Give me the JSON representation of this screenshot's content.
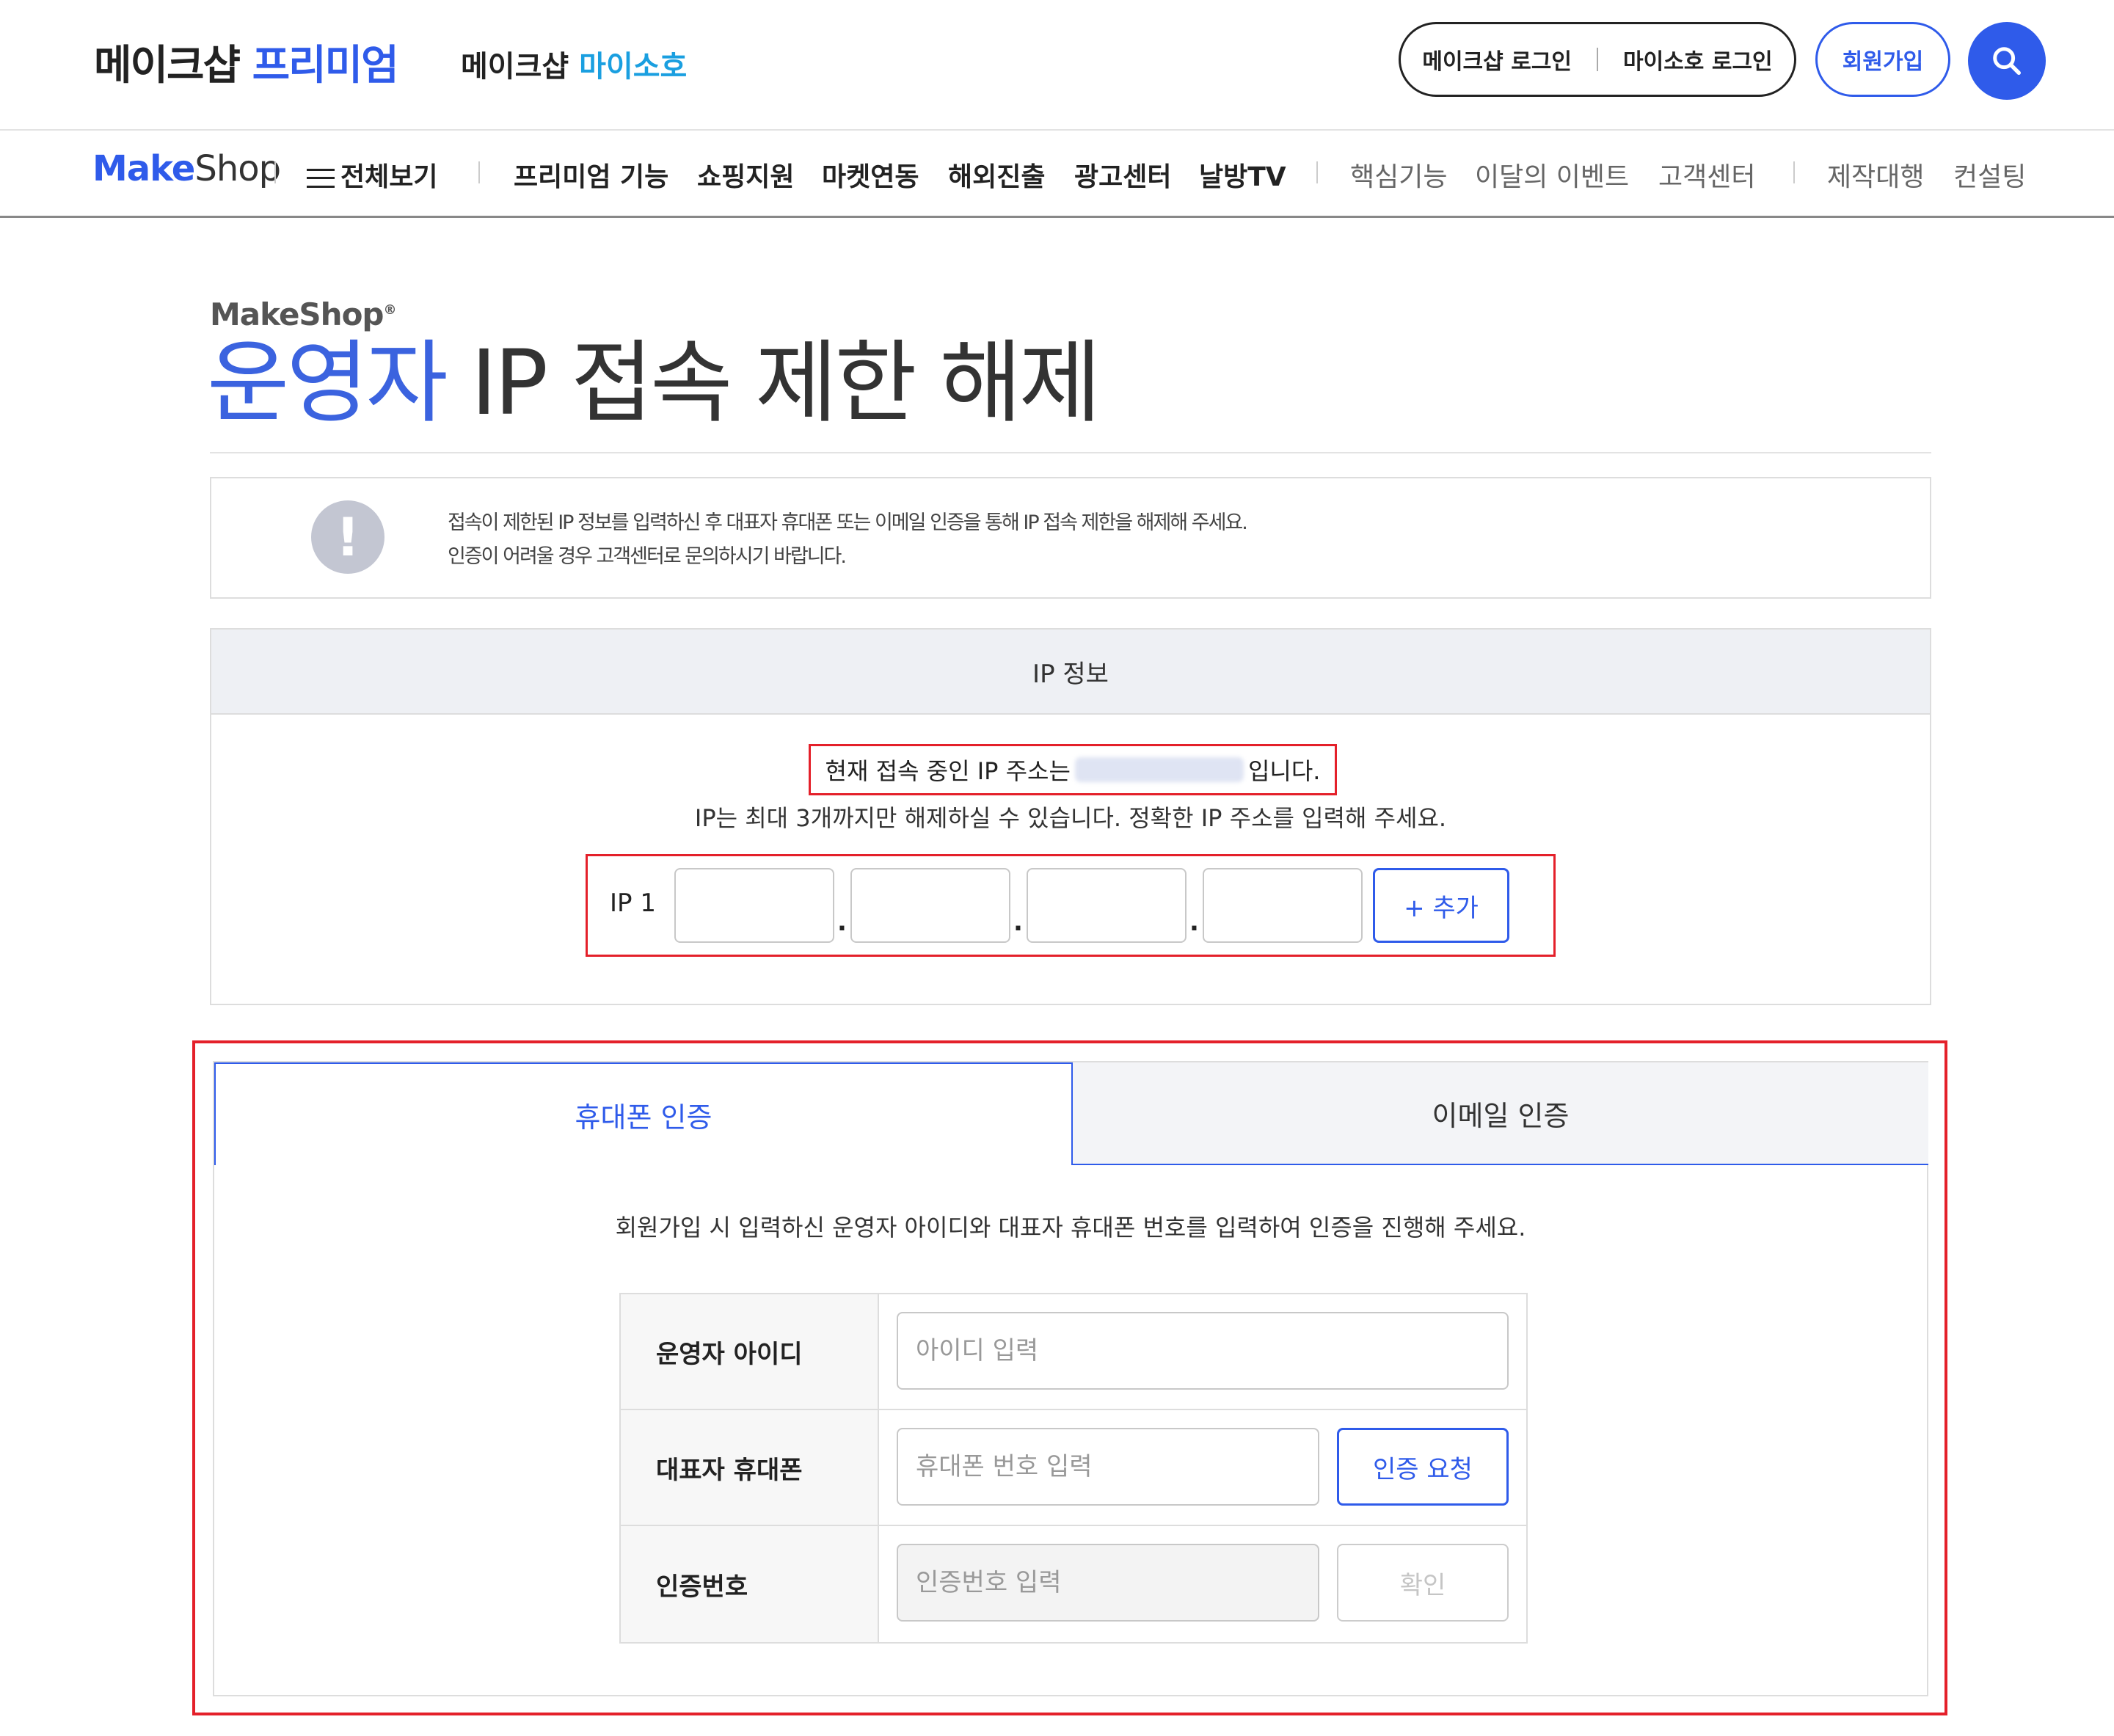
{
  "header": {
    "brand_premium_main": "메이크샵",
    "brand_premium_accent": "프리미엄",
    "brand_myshop_main": "메이크샵",
    "brand_myshop_accent": "마이소호",
    "makeshop_login": "메이크샵 로그인",
    "myshop_login": "마이소호 로그인",
    "join": "회원가입",
    "search_icon": "search-icon"
  },
  "nav": {
    "logo_make": "Make",
    "logo_shop": "Shop",
    "all_menu": "전체보기",
    "items_primary": [
      "프리미엄 기능",
      "쇼핑지원",
      "마켓연동",
      "해외진출",
      "광고센터",
      "날방TV"
    ],
    "items_secondary": [
      "핵심기능",
      "이달의 이벤트",
      "고객센터"
    ],
    "items_tertiary": [
      "제작대행",
      "컨설팅"
    ]
  },
  "page": {
    "logo": "MakeShop",
    "logo_mark": "®",
    "title_accent": "운영자",
    "title_rest": "IP 접속 제한 해제"
  },
  "notice": {
    "line1": "접속이 제한된 IP 정보를 입력하신 후 대표자 휴대폰 또는 이메일 인증을 통해 IP 접속 제한을 해제해 주세요.",
    "line2": "인증이 어려울 경우 고객센터로 문의하시기 바랍니다.",
    "icon": "exclamation-icon"
  },
  "ip_info": {
    "header": "IP 정보",
    "current_prefix": "현재 접속 중인 IP 주소는",
    "current_suffix": "입니다.",
    "help": "IP는 최대 3개까지만 해제하실 수 있습니다. 정확한 IP 주소를 입력해 주세요.",
    "ip_label": "IP 1",
    "dot": ".",
    "add_button": "+ 추가"
  },
  "auth": {
    "tab_phone": "휴대폰 인증",
    "tab_email": "이메일 인증",
    "description": "회원가입 시 입력하신 운영자 아이디와 대표자 휴대폰 번호를 입력하여 인증을 진행해 주세요.",
    "rows": [
      {
        "label": "운영자 아이디",
        "placeholder": "아이디 입력"
      },
      {
        "label": "대표자 휴대폰",
        "placeholder": "휴대폰 번호 입력",
        "button": "인증 요청"
      },
      {
        "label": "인증번호",
        "placeholder": "인증번호 입력",
        "button": "확인"
      }
    ]
  },
  "colors": {
    "accent": "#2f5bea",
    "highlight_border": "#e4202a"
  }
}
